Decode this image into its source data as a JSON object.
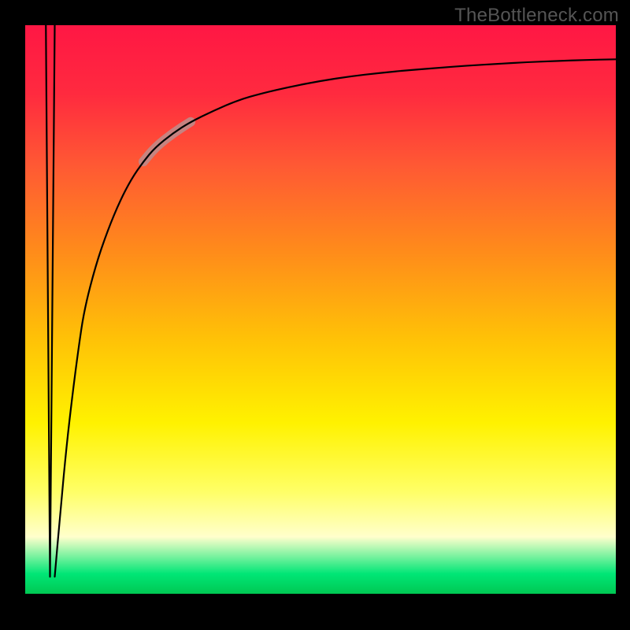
{
  "watermark": "TheBottleneck.com",
  "chart_data": {
    "type": "line",
    "title": "",
    "xlabel": "",
    "ylabel": "",
    "xlim": [
      0,
      100
    ],
    "ylim": [
      0,
      100
    ],
    "background_gradient": {
      "stops": [
        {
          "offset": 0.0,
          "color": "#ff1744"
        },
        {
          "offset": 0.12,
          "color": "#ff2a3f"
        },
        {
          "offset": 0.25,
          "color": "#ff5a33"
        },
        {
          "offset": 0.4,
          "color": "#ff8c1a"
        },
        {
          "offset": 0.55,
          "color": "#ffc107"
        },
        {
          "offset": 0.7,
          "color": "#fff200"
        },
        {
          "offset": 0.82,
          "color": "#ffff66"
        },
        {
          "offset": 0.9,
          "color": "#ffffcc"
        },
        {
          "offset": 0.965,
          "color": "#00e676"
        },
        {
          "offset": 1.0,
          "color": "#00c853"
        }
      ]
    },
    "series": [
      {
        "name": "spike-down",
        "x": [
          3.5,
          4.2,
          5.0
        ],
        "y": [
          100,
          3,
          100
        ],
        "note": "rendered visually as a sharp narrow V-notch near top-left descending to near bottom"
      },
      {
        "name": "log-curve",
        "x": [
          5.0,
          6,
          7,
          8,
          9,
          10,
          12,
          14,
          16,
          18,
          20,
          22,
          25,
          28,
          32,
          36,
          40,
          45,
          50,
          55,
          60,
          65,
          70,
          75,
          80,
          85,
          90,
          95,
          100
        ],
        "y": [
          3,
          15,
          26,
          35,
          43,
          50,
          58,
          64,
          69,
          73,
          76,
          78.5,
          81,
          83,
          85,
          86.8,
          88,
          89.2,
          90.2,
          91,
          91.6,
          92.1,
          92.5,
          92.9,
          93.2,
          93.5,
          93.7,
          93.9,
          94.0
        ]
      }
    ],
    "highlight_segment": {
      "on_series": "log-curve",
      "x_range": [
        20,
        28
      ],
      "color": "#c08a88",
      "width": 12
    },
    "frame": {
      "color": "#000000",
      "margin_left": 32,
      "margin_right": 18,
      "margin_top": 32,
      "margin_bottom": 46
    }
  }
}
